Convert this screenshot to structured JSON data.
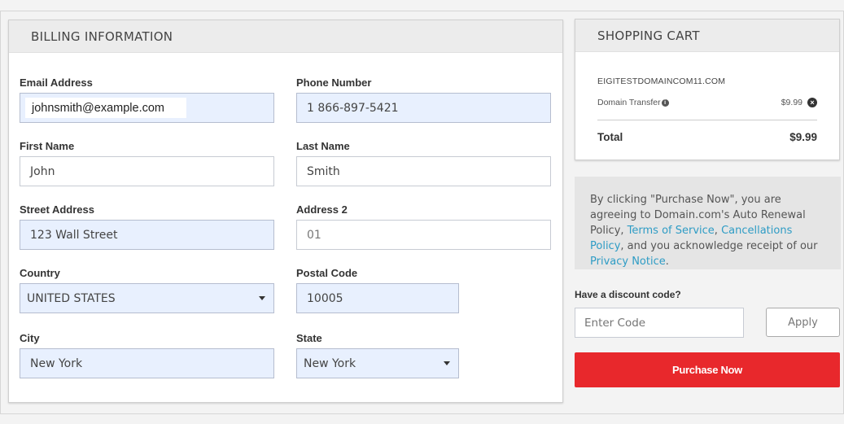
{
  "billing": {
    "title": "BILLING INFORMATION",
    "email": {
      "label": "Email Address",
      "value": "johnsmith@example.com"
    },
    "phone": {
      "label": "Phone Number",
      "value": "1 866-897-5421"
    },
    "first_name": {
      "label": "First Name",
      "value": "John"
    },
    "last_name": {
      "label": "Last Name",
      "value": "Smith"
    },
    "street": {
      "label": "Street Address",
      "value": "123 Wall Street"
    },
    "address2": {
      "label": "Address 2",
      "placeholder": "01"
    },
    "country": {
      "label": "Country",
      "value": "UNITED STATES"
    },
    "postal": {
      "label": "Postal Code",
      "value": "10005"
    },
    "city": {
      "label": "City",
      "value": "New York"
    },
    "state": {
      "label": "State",
      "value": "New York"
    }
  },
  "cart": {
    "title": "SHOPPING CART",
    "domain": "EIGITESTDOMAINCOM11.COM",
    "item_label": "Domain Transfer",
    "item_price": "$9.99",
    "total_label": "Total",
    "total_value": "$9.99",
    "info_icon": "info-icon",
    "remove_icon": "close-circle-icon"
  },
  "agreement": {
    "text_1": "By clicking \"Purchase Now\", you are agreeing to Domain.com's Auto Renewal Policy, ",
    "link_terms": "Terms of Service",
    "text_2": ", ",
    "link_cancel": "Cancellations Policy",
    "text_3": ", and you acknowledge receipt of our ",
    "link_privacy": "Privacy Notice",
    "text_4": "."
  },
  "discount": {
    "label": "Have a discount code?",
    "placeholder": "Enter Code",
    "apply_label": "Apply"
  },
  "purchase": {
    "label": "Purchase Now"
  },
  "colors": {
    "accent_red": "#e8282c",
    "link_blue": "#2e9cc5",
    "autofill_blue": "#e8f0fe"
  }
}
